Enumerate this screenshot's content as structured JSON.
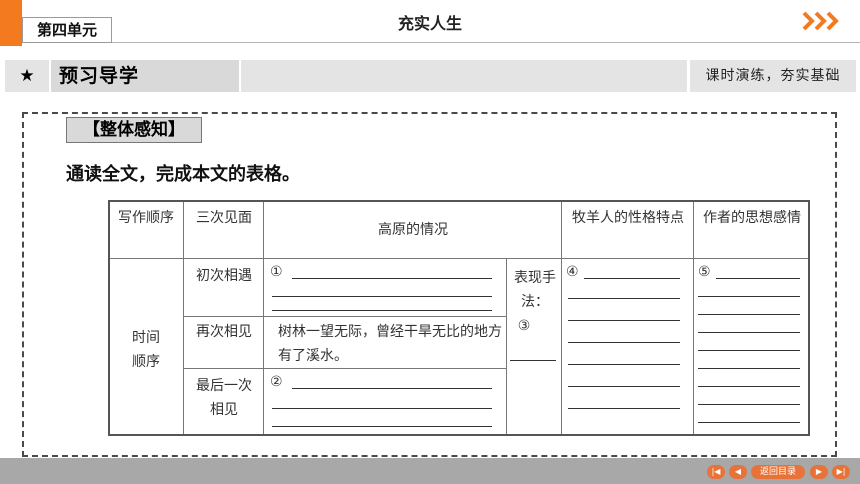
{
  "header": {
    "unit_label": "第四单元",
    "title": "充实人生"
  },
  "section": {
    "star": "★",
    "title": "预习导学",
    "right_text": "课时演练，夯实基础"
  },
  "panel": {
    "tag": "【整体感知】",
    "instruction": "通读全文，完成本文的表格。"
  },
  "table": {
    "headers": {
      "order": "写作顺序",
      "meetings": "三次见面",
      "plateau": "高原的情况",
      "traits": "牧羊人的性格特点",
      "feelings": "作者的思想感情"
    },
    "time_order": "时间顺序",
    "rows": [
      {
        "meeting": "初次相遇",
        "content": "①"
      },
      {
        "meeting": "再次相见",
        "content": "树林一望无际，曾经干旱无比的地方有了溪水。"
      },
      {
        "meeting": "最后一次相见",
        "content": "②"
      }
    ],
    "method_label": "表现手法：",
    "method_marker": "③",
    "traits_marker": "④",
    "feelings_marker": "⑤"
  },
  "footer": {
    "home_label": "返回目录"
  },
  "colors": {
    "accent": "#f47a20",
    "section_bg": "#e4e4e4",
    "footer_bg": "#a8a8a8"
  }
}
